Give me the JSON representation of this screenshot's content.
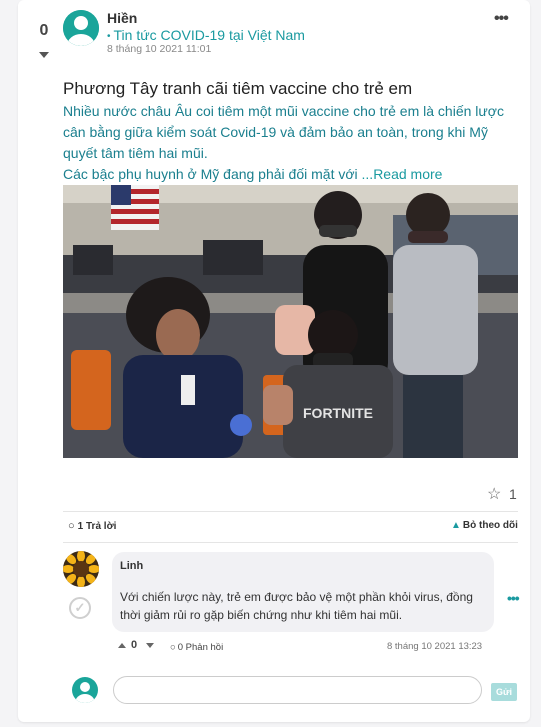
{
  "post": {
    "votes": "0",
    "author": "Hiền",
    "group": "Tin tức COVID-19 tại Việt Nam",
    "group_bullet": "•",
    "timestamp": "8 tháng 10 2021 11:01",
    "title": "Phương Tây tranh cãi tiêm vaccine cho trẻ em",
    "body_line1": "Nhiều nước châu Âu coi tiêm một mũi vaccine cho trẻ em là chiến lược cân bằng giữa kiểm soát Covid-19 và đảm bảo an toàn, trong khi Mỹ quyết tâm tiêm hai mũi.",
    "body_line2": "Các bậc phụ huynh ở Mỹ đang phải đối mặt với ",
    "read_more": "...Read more",
    "image_label": "FORTNITE",
    "star_count": "1",
    "more_icon": "•••"
  },
  "actions": {
    "reply_count": "1 Trả lời",
    "follow": "Bỏ theo dõi"
  },
  "comment": {
    "author": "Linh",
    "text": "Với chiến lược này, trẻ em được bảo vệ một phần khỏi virus, đồng thời giảm rủi ro gặp biến chứng như khi tiêm hai mũi.",
    "votes": "0",
    "reply_label": "0 Phản hồi",
    "timestamp": "8 tháng 10 2021 13:23",
    "more_icon": "•••",
    "check_icon": "✓"
  },
  "reply_box": {
    "placeholder": "",
    "send_label": "Gửi"
  },
  "colors": {
    "accent": "#1a9aa0",
    "avatar_teal": "#1aa59a"
  },
  "icons": {
    "star": "☆",
    "comment": "💬",
    "bell": "🔔"
  }
}
